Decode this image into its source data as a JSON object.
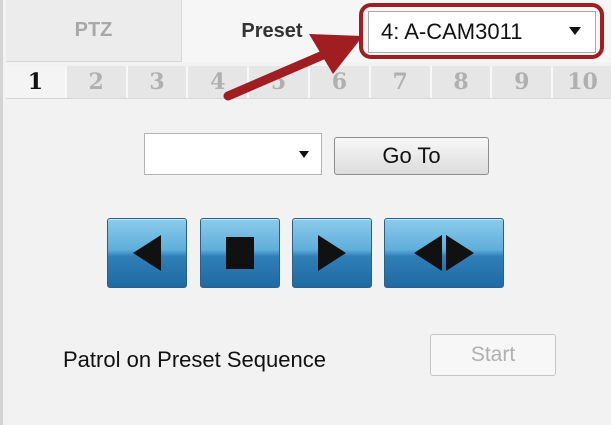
{
  "tabs": {
    "ptz_label": "PTZ",
    "preset_label": "Preset"
  },
  "camera_select": {
    "selected_value": "4: A-CAM3011"
  },
  "preset_numbers": [
    "1",
    "2",
    "3",
    "4",
    "5",
    "6",
    "7",
    "8",
    "9",
    "10"
  ],
  "active_preset": "1",
  "preset_select": {
    "selected_value": ""
  },
  "goto_label": "Go To",
  "controls": {
    "prev_icon": "triangle-left-icon",
    "stop_icon": "square-stop-icon",
    "next_icon": "triangle-right-icon",
    "both_icon": "left-right-icon"
  },
  "patrol": {
    "label": "Patrol on Preset Sequence",
    "start_label": "Start"
  },
  "colors": {
    "highlight": "#a01e22",
    "button_blue": "#2f7fb8"
  }
}
